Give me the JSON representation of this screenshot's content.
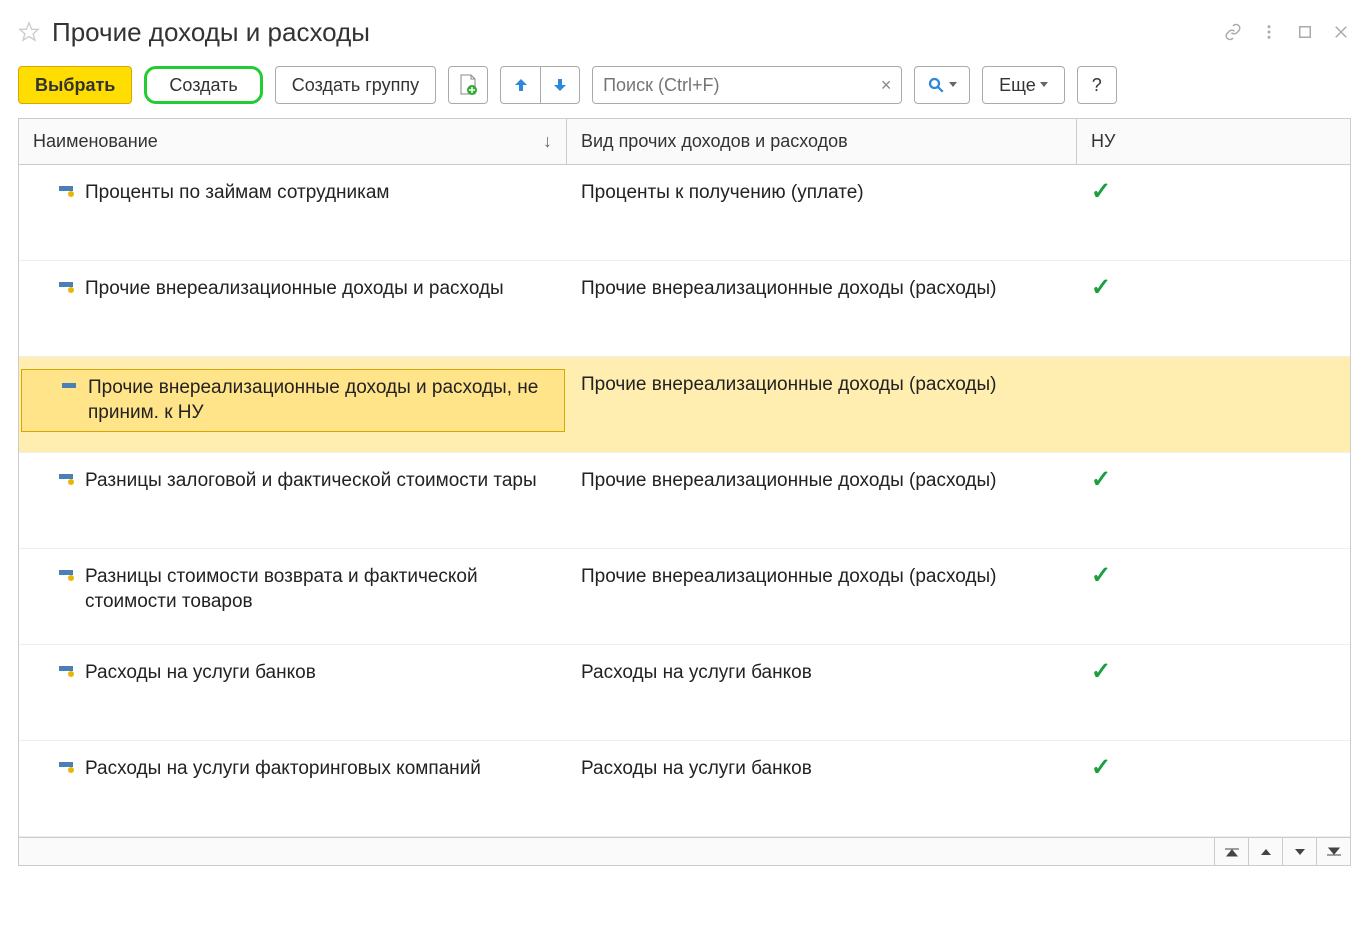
{
  "title": "Прочие доходы и расходы",
  "toolbar": {
    "select_label": "Выбрать",
    "create_label": "Создать",
    "create_group_label": "Создать группу",
    "more_label": "Еще",
    "help_label": "?"
  },
  "search": {
    "placeholder": "Поиск (Ctrl+F)"
  },
  "table": {
    "headers": {
      "name": "Наименование",
      "type": "Вид прочих доходов и расходов",
      "nu": "НУ"
    },
    "rows": [
      {
        "name": "Проценты по займам сотрудникам",
        "type": "Проценты к получению (уплате)",
        "nu": true,
        "selected": false
      },
      {
        "name": "Прочие внереализационные доходы и расходы",
        "type": "Прочие внереализационные доходы (расходы)",
        "nu": true,
        "selected": false
      },
      {
        "name": "Прочие внереализационные доходы и расходы, не приним. к НУ",
        "type": "Прочие внереализационные доходы (расходы)",
        "nu": false,
        "selected": true
      },
      {
        "name": "Разницы залоговой и фактической стоимости тары",
        "type": "Прочие внереализационные доходы (расходы)",
        "nu": true,
        "selected": false
      },
      {
        "name": "Разницы стоимости возврата и фактической стоимости товаров",
        "type": "Прочие внереализационные доходы (расходы)",
        "nu": true,
        "selected": false
      },
      {
        "name": "Расходы на услуги банков",
        "type": "Расходы на услуги банков",
        "nu": true,
        "selected": false
      },
      {
        "name": "Расходы на услуги факторинговых компаний",
        "type": "Расходы на услуги банков",
        "nu": true,
        "selected": false
      }
    ]
  }
}
